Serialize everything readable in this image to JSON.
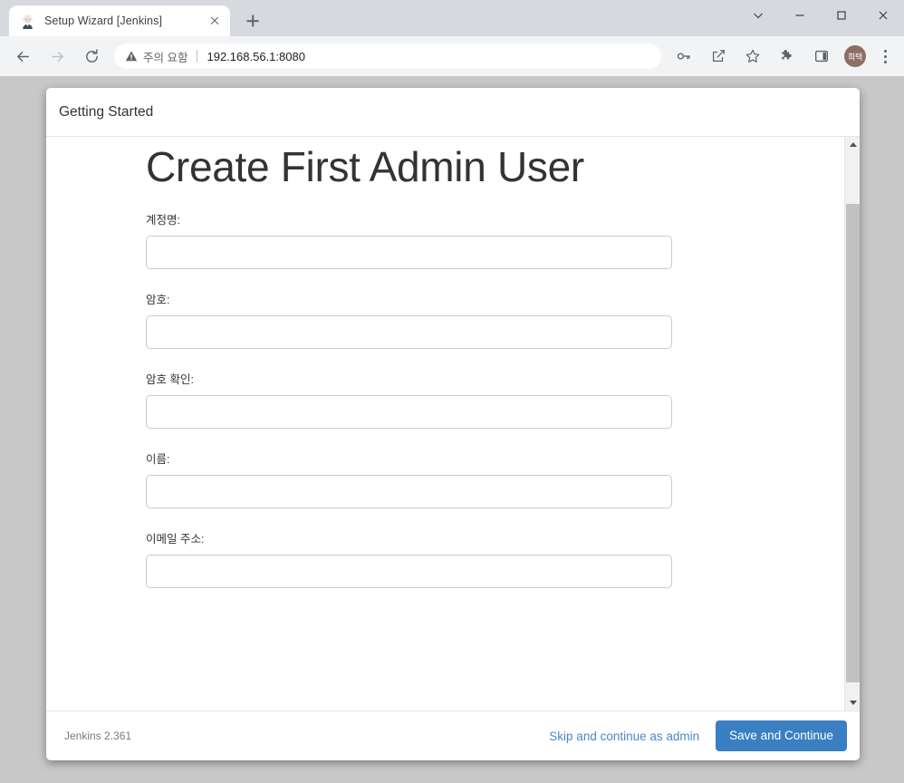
{
  "browser": {
    "tab": {
      "title": "Setup Wizard [Jenkins]",
      "favicon": "jenkins-butler-icon",
      "close_icon": "close-icon"
    },
    "new_tab_icon": "plus-icon",
    "window_controls": {
      "tab_search_icon": "chevron-down-icon",
      "minimize_icon": "minimize-icon",
      "maximize_icon": "maximize-icon",
      "close_icon": "close-icon"
    },
    "toolbar": {
      "back_icon": "arrow-left-icon",
      "forward_icon": "arrow-right-icon",
      "reload_icon": "reload-icon",
      "security_label": "주의 요함",
      "security_icon": "warning-triangle-icon",
      "url": "192.168.56.1:8080",
      "password_key_icon": "key-icon",
      "share_icon": "share-icon",
      "bookmark_icon": "star-icon",
      "extensions_icon": "puzzle-icon",
      "side_panel_icon": "side-panel-icon",
      "avatar_label": "희택",
      "menu_icon": "three-dot-menu-icon"
    }
  },
  "dialog": {
    "header_title": "Getting Started",
    "page_title": "Create First Admin User",
    "fields": [
      {
        "label": "계정명:",
        "value": "",
        "placeholder": "",
        "name": "username-field"
      },
      {
        "label": "암호:",
        "value": "",
        "placeholder": "",
        "name": "password-field"
      },
      {
        "label": "암호 확인:",
        "value": "",
        "placeholder": "",
        "name": "confirm-password-field"
      },
      {
        "label": "이름:",
        "value": "",
        "placeholder": "",
        "name": "fullname-field"
      },
      {
        "label": "이메일 주소:",
        "value": "",
        "placeholder": "",
        "name": "email-field"
      }
    ],
    "footer": {
      "version": "Jenkins 2.361",
      "skip_label": "Skip and continue as admin",
      "save_label": "Save and Continue"
    },
    "scrollbar": {
      "up_arrow_icon": "scroll-up-arrow-icon",
      "down_arrow_icon": "scroll-down-arrow-icon"
    }
  },
  "colors": {
    "primary_button": "#3a7fc1",
    "link": "#4a89c8",
    "page_background": "#c8c8c8",
    "input_border": "#c3ccd3",
    "avatar": "#8d6f63"
  }
}
